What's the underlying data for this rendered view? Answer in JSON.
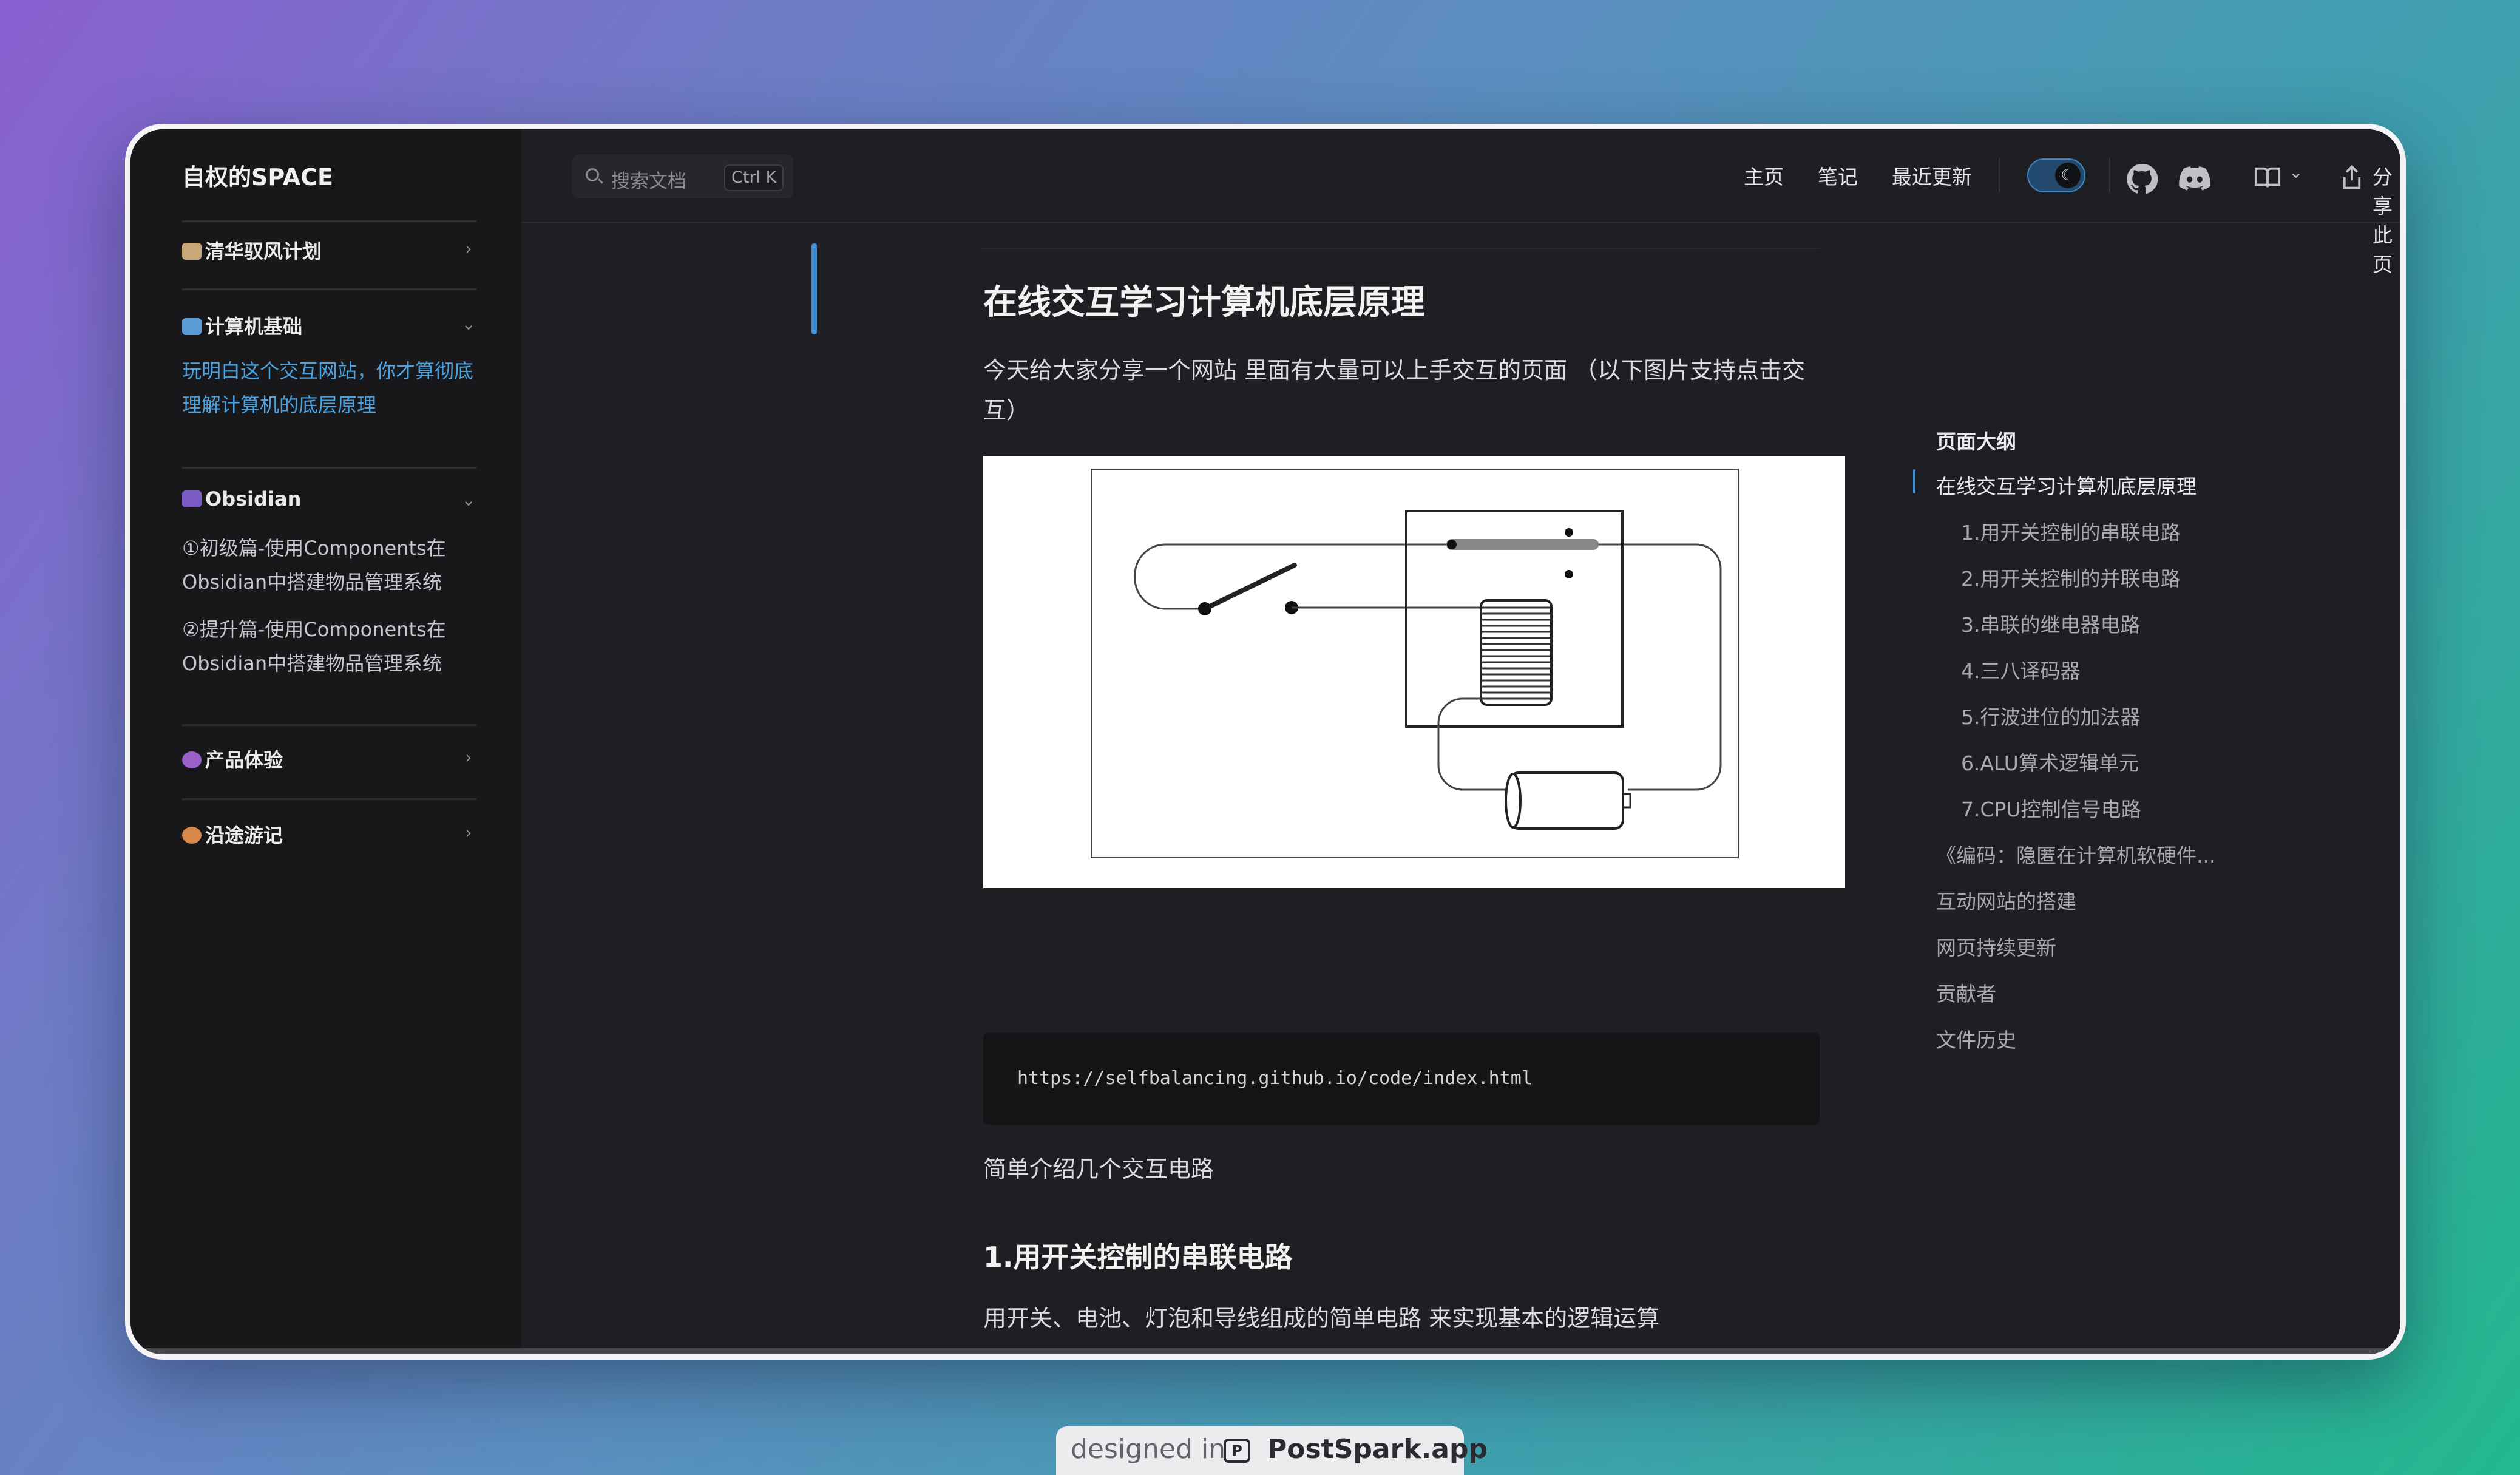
{
  "sidebar": {
    "brand": "自权的SPACE",
    "sections": [
      {
        "label": "清华驭风计划",
        "emoji_icon": "school-icon"
      },
      {
        "label": "计算机基础",
        "emoji_icon": "laptop-icon",
        "items": [
          "玩明白这个交互网站，你才算彻底理解计算机的底层原理"
        ]
      },
      {
        "label": "Obsidian",
        "emoji_icon": "notebook-icon",
        "items": [
          "①初级篇-使用Components在Obsidian中搭建物品管理系统",
          "②提升篇-使用Components在Obsidian中搭建物品管理系统"
        ]
      },
      {
        "label": "产品体验",
        "emoji_icon": "eggplant-icon"
      },
      {
        "label": "沿途游记",
        "emoji_icon": "compass-icon"
      }
    ]
  },
  "topbar": {
    "search_placeholder": "搜索文档",
    "search_shortcut": "Ctrl K",
    "nav": [
      "主页",
      "笔记",
      "最近更新"
    ],
    "share_label": "分享此页"
  },
  "article": {
    "title": "在线交互学习计算机底层原理",
    "intro": "今天给大家分享一个网站 里面有大量可以上手交互的页面 （以下图片支持点击交互）",
    "code_url": "https://selfbalancing.github.io/code/index.html",
    "after_code": "简单介绍几个交互电路",
    "section1_title": "1.用开关控制的串联电路",
    "section1_text": "用开关、电池、灯泡和导线组成的简单电路 来实现基本的逻辑运算"
  },
  "outline": {
    "heading": "页面大纲",
    "items": [
      "在线交互学习计算机底层原理",
      "1.用开关控制的串联电路",
      "2.用开关控制的并联电路",
      "3.串联的继电器电路",
      "4.三八译码器",
      "5.行波进位的加法器",
      "6.ALU算术逻辑单元",
      "7.CPU控制信号电路",
      "《编码：隐匿在计算机软硬件...",
      "互动网站的搭建",
      "网页持续更新",
      "贡献者",
      "文件历史"
    ]
  },
  "footer": {
    "designed_in": "designed in",
    "app": "PostSpark.app"
  },
  "colors": {
    "accent": "#3a8fd6",
    "link": "#4aa3e0",
    "background": "#1e1f23",
    "sidebar": "#18181b"
  }
}
